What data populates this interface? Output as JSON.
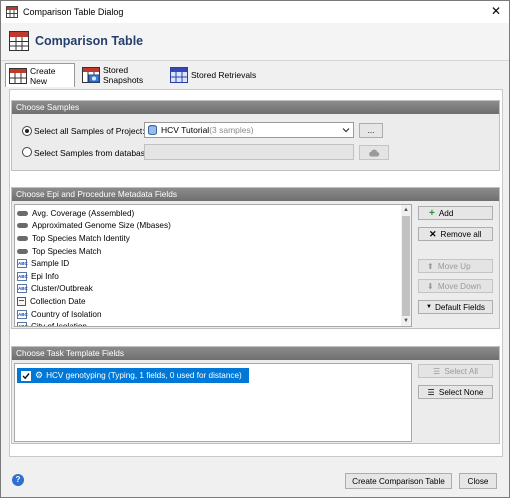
{
  "window": {
    "title": "Comparison Table Dialog",
    "close_glyph": "✕"
  },
  "header": {
    "title": "Comparison Table"
  },
  "tabs": [
    {
      "label": "Create New",
      "icon": "table-icon"
    },
    {
      "label": "Stored Snapshots",
      "icon": "camera-table-icon"
    },
    {
      "label": "Stored Retrievals",
      "icon": "grid-table-icon"
    }
  ],
  "samples": {
    "heading": "Choose Samples",
    "option_project": "Select all Samples of Project:",
    "project_name": "HCV Tutorial",
    "project_count": " (3 samples)",
    "browse": "...",
    "option_database": "Select Samples from database:"
  },
  "metadata": {
    "heading": "Choose Epi and Procedure Metadata Fields",
    "items": [
      {
        "label": "Avg. Coverage (Assembled)",
        "icon": "pill"
      },
      {
        "label": "Approximated Genome Size (Mbases)",
        "icon": "pill"
      },
      {
        "label": "Top Species Match Identity",
        "icon": "pill"
      },
      {
        "label": "Top Species Match",
        "icon": "pill"
      },
      {
        "label": "Sample ID",
        "icon": "abc"
      },
      {
        "label": "Epi Info",
        "icon": "abc"
      },
      {
        "label": "Cluster/Outbreak",
        "icon": "abc"
      },
      {
        "label": "Collection Date",
        "icon": "cal"
      },
      {
        "label": "Country of Isolation",
        "icon": "abc"
      },
      {
        "label": "City of Isolation",
        "icon": "abc"
      }
    ],
    "buttons": {
      "add": "Add",
      "remove_all": "Remove all",
      "move_up": "Move Up",
      "move_down": "Move Down",
      "default_fields": "Default Fields"
    }
  },
  "task": {
    "heading": "Choose Task Template Fields",
    "item_label": "HCV genotyping (Typing, 1 fields, 0 used for distance)",
    "item_checked": true,
    "select_all": "Select All",
    "select_none": "Select None"
  },
  "footer": {
    "create": "Create Comparison Table",
    "close": "Close",
    "help_glyph": "?"
  },
  "colors": {
    "accent": "#26406e",
    "selection": "#0078d7",
    "panel_header": "#7a7a7a"
  }
}
